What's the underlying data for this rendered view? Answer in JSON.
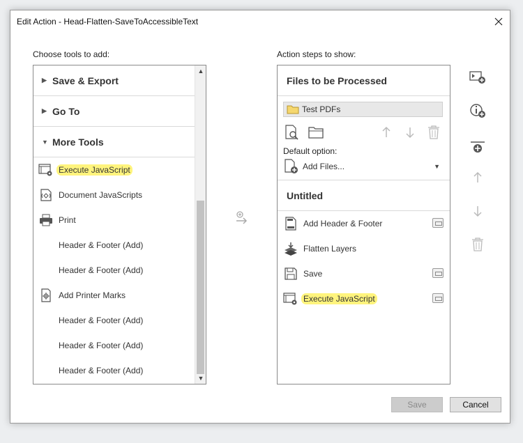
{
  "dialog": {
    "title": "Edit Action - Head-Flatten-SaveToAccessibleText"
  },
  "left": {
    "label": "Choose tools to add:",
    "groups": [
      {
        "label": "Save & Export",
        "expanded": false
      },
      {
        "label": "Go To",
        "expanded": false
      },
      {
        "label": "More Tools",
        "expanded": true
      }
    ],
    "tools": [
      {
        "label": "Execute JavaScript",
        "icon": "execute-javascript-icon",
        "highlighted": true
      },
      {
        "label": "Document JavaScripts",
        "icon": "document-javascripts-icon"
      },
      {
        "label": "Print",
        "icon": "printer-icon"
      },
      {
        "label": "Header & Footer (Add)"
      },
      {
        "label": "Header & Footer (Add)"
      },
      {
        "label": "Add Printer Marks",
        "icon": "printer-marks-icon"
      },
      {
        "label": "Header & Footer (Add)"
      },
      {
        "label": "Header & Footer (Add)"
      },
      {
        "label": "Header & Footer (Add)"
      }
    ]
  },
  "right": {
    "label": "Action steps to show:",
    "files_header": "Files to be Processed",
    "file_item": "Test PDFs",
    "default_option_label": "Default option:",
    "add_files_label": "Add Files...",
    "section_title": "Untitled",
    "steps": [
      {
        "label": "Add Header & Footer",
        "icon": "header-footer-icon",
        "has_options": true
      },
      {
        "label": "Flatten Layers",
        "icon": "flatten-layers-icon",
        "has_options": false
      },
      {
        "label": "Save",
        "icon": "save-icon",
        "has_options": true
      },
      {
        "label": "Execute JavaScript",
        "icon": "execute-javascript-icon",
        "has_options": true,
        "highlighted": true
      }
    ]
  },
  "buttons": {
    "save": "Save",
    "cancel": "Cancel"
  }
}
